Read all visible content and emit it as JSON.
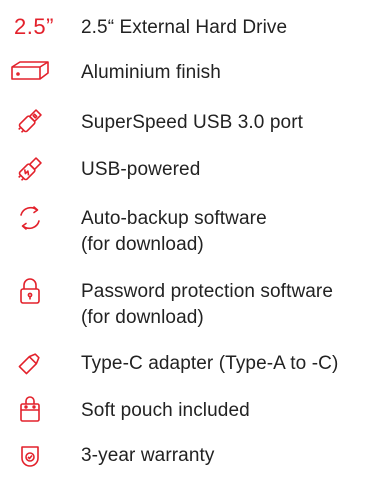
{
  "accent_color": "#e3212b",
  "features": [
    {
      "icon": "size-2-5-inch-icon",
      "icon_text": "2.5”",
      "lines": [
        "2.5“ External Hard Drive"
      ]
    },
    {
      "icon": "drive-enclosure-icon",
      "lines": [
        "Aluminium finish"
      ]
    },
    {
      "icon": "usb-plug-icon",
      "lines": [
        "SuperSpeed USB 3.0 port"
      ]
    },
    {
      "icon": "usb-power-icon",
      "lines": [
        "USB-powered"
      ]
    },
    {
      "icon": "sync-arrows-icon",
      "lines": [
        "Auto-backup software",
        "(for download)"
      ]
    },
    {
      "icon": "padlock-icon",
      "lines": [
        "Password protection software",
        "(for download)"
      ]
    },
    {
      "icon": "usb-c-adapter-icon",
      "lines": [
        "Type-C adapter (Type-A to -C)"
      ]
    },
    {
      "icon": "pouch-bag-icon",
      "lines": [
        "Soft pouch included"
      ]
    },
    {
      "icon": "warranty-shield-icon",
      "lines": [
        "3-year warranty"
      ]
    }
  ]
}
